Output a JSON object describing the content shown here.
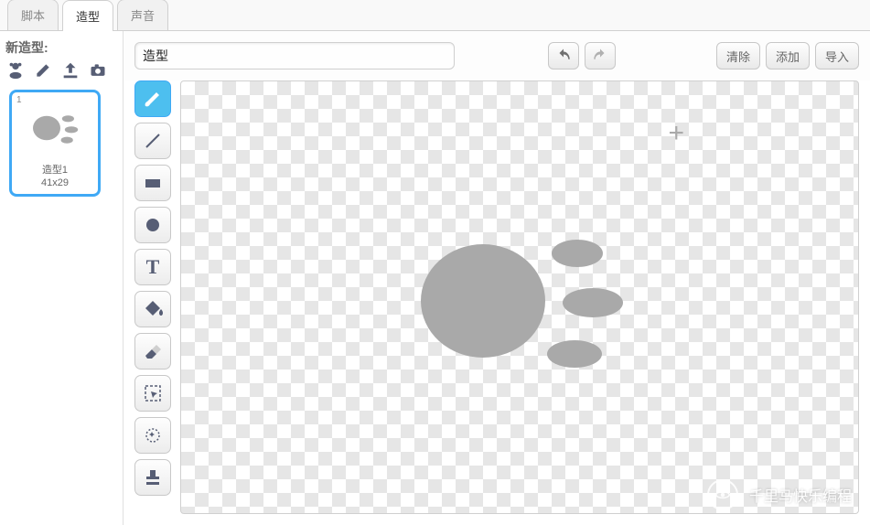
{
  "tabs": {
    "scripts": "脚本",
    "costumes": "造型",
    "sounds": "声音"
  },
  "left": {
    "newCostumeLabel": "新造型:",
    "thumbNumber": "1",
    "thumbName": "造型1",
    "thumbDimensions": "41x29"
  },
  "toolbar": {
    "nameValue": "造型",
    "clear": "清除",
    "add": "添加",
    "import": "导入"
  },
  "tools": {
    "brush": "brush",
    "line": "line",
    "rect": "rect",
    "ellipse": "ellipse",
    "text": "text",
    "fill": "fill",
    "eraser": "eraser",
    "select": "select",
    "wand": "wand",
    "stamp": "stamp"
  },
  "icons": {
    "library": "library",
    "paint": "paint",
    "upload": "upload",
    "camera": "camera",
    "undo": "undo",
    "redo": "redo"
  },
  "watermark": "千里马快乐编程"
}
